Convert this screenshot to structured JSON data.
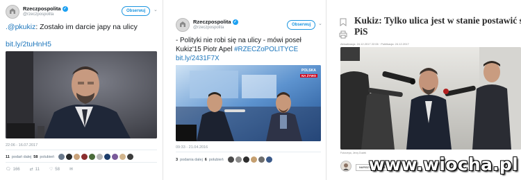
{
  "tweet1": {
    "account_name": "Rzeczpospolita",
    "handle": "@rzeczpospolita",
    "follow_label": "Obserwuj",
    "mention": ".@pkukiz",
    "text": ": Zostało im darcie japy na ulicy",
    "link": "bit.ly/2tuHnH5",
    "timestamp": "22:06 - 16.07.2017",
    "retweets_count": "11",
    "retweets_label": "podań dalej",
    "likes_count": "58",
    "likes_label": "polubień",
    "reply_count": "166",
    "retweet_action_count": "11",
    "like_action_count": "58",
    "liker_colors": [
      "#6b7a8c",
      "#2a2a2a",
      "#c9a27a",
      "#8b2e2e",
      "#4a6b3a",
      "#b7b7b7",
      "#1d3d6b",
      "#7a5a9a",
      "#d1b48c",
      "#3c3c3c"
    ]
  },
  "tweet2": {
    "account_name": "Rzeczpospolita",
    "handle": "@rzeczpospolita",
    "follow_label": "Obserwuj",
    "line1": "- Polityki nie robi się na ulicy - mówi poseł",
    "line2_plain": "Kukiz'15 Piotr Apel ",
    "hashtag": "#RZECZoPOLITYCE",
    "link": "bit.ly/2431F7X",
    "tv_logo": "POLSKA",
    "live_label": "NA ŻYWO",
    "timestamp": "09:33 - 21.04.2016",
    "retweets_count": "3",
    "retweets_label": "podania dalej",
    "likes_count": "6",
    "likes_label": "polubień",
    "liker_colors": [
      "#4a4a4a",
      "#8a8a8a",
      "#2d2d2d",
      "#c59f70",
      "#6d6d6d",
      "#3b5a8a"
    ]
  },
  "article": {
    "title_line1": "Kukiz: Tylko ulica jest w stanie postawić się",
    "title_line2": "PiS",
    "dates": "Aktualizacja: 24.12.2017 22:06 · Publikacja: 24.12.2017",
    "photo_caption": "Fotorzepa, Jerzy Dudek",
    "author_button": "NAPISZ DO AUTORA"
  },
  "watermark": "www.wiocha.pl"
}
